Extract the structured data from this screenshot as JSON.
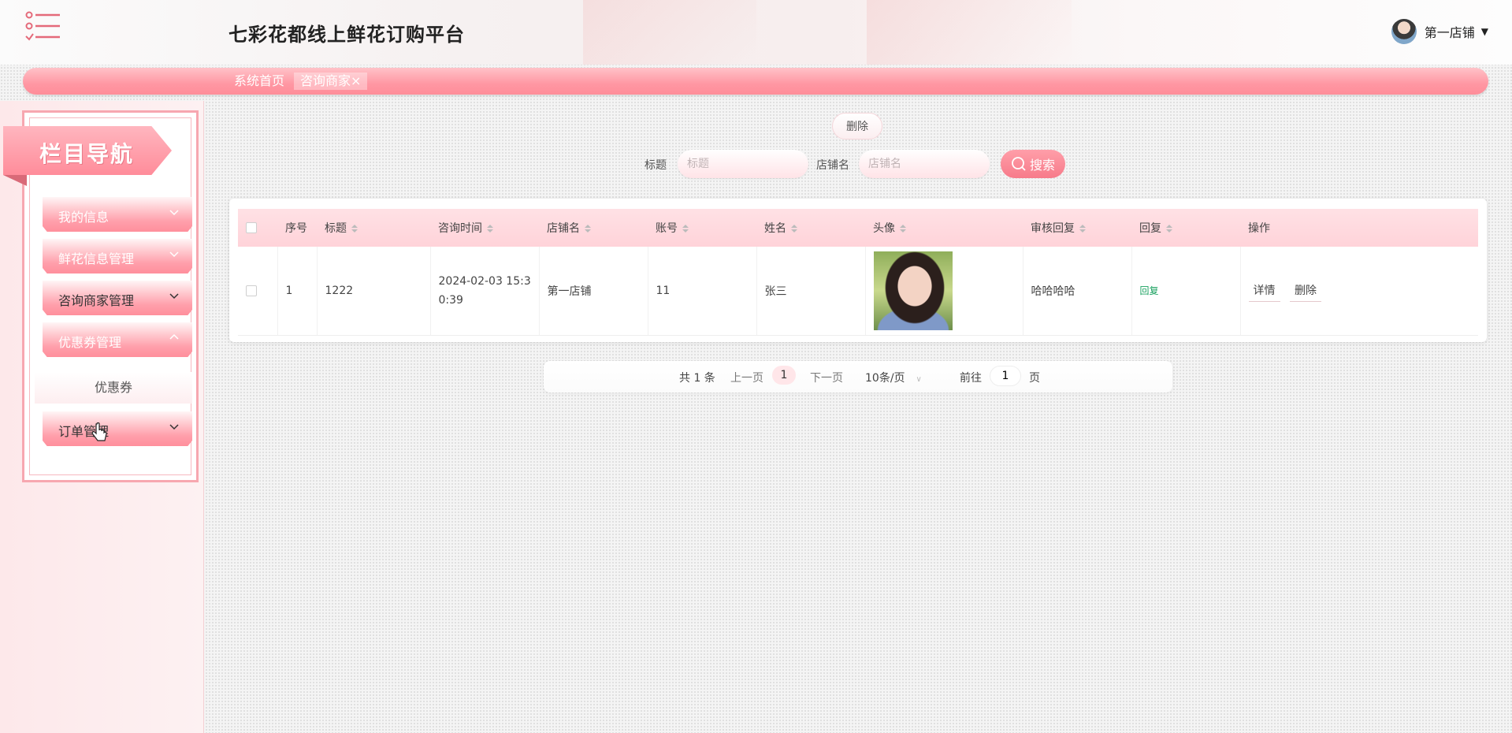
{
  "header": {
    "title": "七彩花都线上鲜花订购平台",
    "user_name": "第一店铺",
    "menu_icon": "menu-list-icon",
    "avatar_icon": "avatar"
  },
  "tabs": [
    {
      "label": "系统首页"
    },
    {
      "label": "咨询商家×"
    }
  ],
  "sidebar": {
    "banner": "栏目导航",
    "items": [
      {
        "label": "我的信息",
        "chevron": "chevron-down-icon"
      },
      {
        "label": "鲜花信息管理",
        "chevron": "chevron-down-icon"
      },
      {
        "label": "咨询商家管理",
        "chevron": "chevron-down-icon"
      },
      {
        "label": "优惠券管理",
        "chevron": "chevron-up-icon"
      },
      {
        "label": "订单管理",
        "chevron": "chevron-down-icon"
      }
    ],
    "subitem": "优惠券"
  },
  "toolbar": {
    "delete_label": "删除",
    "search_button": "搜索",
    "search_icon": "search-icon"
  },
  "search": {
    "title_label": "标题",
    "title_placeholder": "标题",
    "shop_label": "店铺名",
    "shop_placeholder": "店铺名"
  },
  "table": {
    "columns": [
      "序号",
      "标题",
      "咨询时间",
      "店铺名",
      "账号",
      "姓名",
      "头像",
      "审核回复",
      "回复",
      "操作"
    ],
    "rows": [
      {
        "index": "1",
        "title": "1222",
        "time": "2024-02-03 15:30:39",
        "shop": "第一店铺",
        "account": "11",
        "name": "张三",
        "avatar": "person-photo",
        "review_reply": "哈哈哈哈",
        "reply": "回复",
        "detail_btn": "详情",
        "delete_btn": "删除"
      }
    ]
  },
  "pagination": {
    "total": "共 1 条",
    "prev": "上一页",
    "current": "1",
    "next": "下一页",
    "page_size": "10条/页",
    "goto_label": "前往",
    "goto_value": "1",
    "page_suffix": "页"
  },
  "colors": {
    "accent": "#ff8d99",
    "accent_light": "#ffd3d9",
    "reply_green": "#19a15f"
  }
}
